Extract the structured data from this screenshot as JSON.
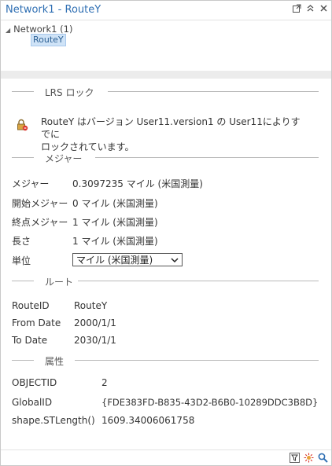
{
  "window": {
    "title": "Network1 - RouteY"
  },
  "titlebar_icons": [
    "pop-out-icon",
    "collapse-icon",
    "close-icon"
  ],
  "tree": {
    "root": "Network1  (1)",
    "child": "RouteY"
  },
  "sections": {
    "lock": "LRS ロック",
    "measure": "メジャー",
    "route": "ルート",
    "attributes": "属性"
  },
  "lock": {
    "line1": "RouteY はバージョン User11.version1 の User11によりすでに",
    "line2": "ロックされています。"
  },
  "measure": {
    "rows": [
      {
        "label": "メジャー",
        "value": "0.3097235 マイル (米国測量)"
      },
      {
        "label": "開始メジャー",
        "value": "0 マイル (米国測量)"
      },
      {
        "label": "終点メジャー",
        "value": "1 マイル (米国測量)"
      },
      {
        "label": "長さ",
        "value": "1 マイル (米国測量)"
      }
    ],
    "units_label": "単位",
    "units_value": "マイル (米国測量)"
  },
  "route": {
    "rows": [
      {
        "label": "RouteID",
        "value": "RouteY"
      },
      {
        "label": "From Date",
        "value": "2000/1/1"
      },
      {
        "label": "To Date",
        "value": "2030/1/1"
      }
    ]
  },
  "attributes": {
    "rows": [
      {
        "label": "OBJECTID",
        "value": "2"
      },
      {
        "label": "GlobalID",
        "value": "{FDE383FD-B835-43D2-B6B0-10289DDC3B8D}"
      },
      {
        "label": "shape.STLength()",
        "value": "1609.34006061758"
      }
    ]
  },
  "bottom_icons": [
    "filter-icon",
    "flash-icon",
    "zoom-icon"
  ],
  "colors": {
    "title": "#2f6fb3",
    "selection": "#cfe3f7",
    "band": "#ececec"
  }
}
